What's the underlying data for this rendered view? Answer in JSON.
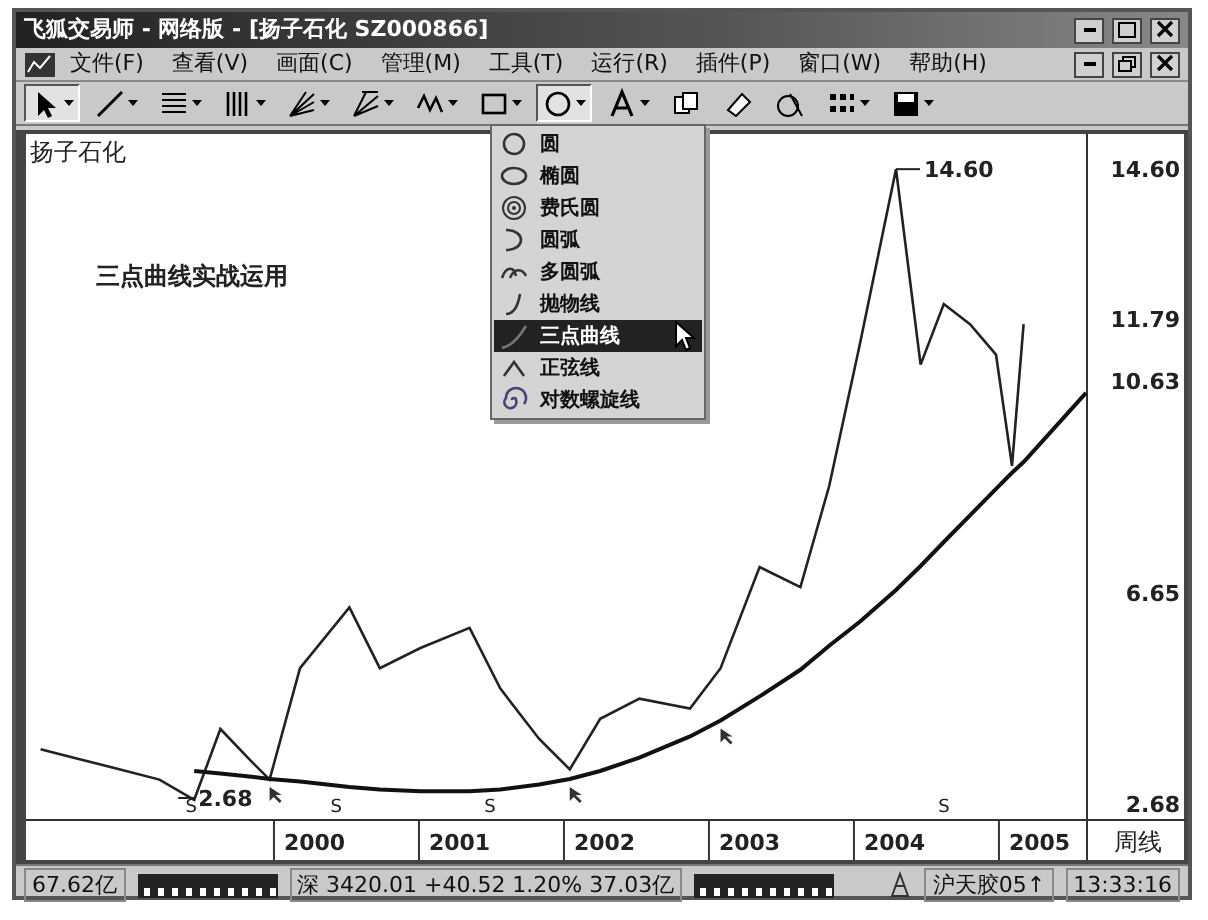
{
  "window": {
    "title": "飞狐交易师 - 网络版 - [扬子石化 SZ000866]"
  },
  "menu": [
    "文件(F)",
    "查看(V)",
    "画面(C)",
    "管理(M)",
    "工具(T)",
    "运行(R)",
    "插件(P)",
    "窗口(W)",
    "帮助(H)"
  ],
  "toolbar": [
    {
      "kind": "pointer",
      "pressed": true
    },
    {
      "kind": "line",
      "pressed": false
    },
    {
      "kind": "fib",
      "pressed": false
    },
    {
      "kind": "vlines",
      "pressed": false
    },
    {
      "kind": "fan",
      "pressed": false
    },
    {
      "kind": "gann",
      "pressed": false
    },
    {
      "kind": "wave",
      "pressed": false
    },
    {
      "kind": "rect",
      "pressed": false
    },
    {
      "kind": "circle",
      "pressed": true
    },
    {
      "kind": "text",
      "pressed": false
    },
    {
      "kind": "copy",
      "pressed": false
    },
    {
      "kind": "eraser",
      "pressed": false
    },
    {
      "kind": "delete",
      "pressed": false
    },
    {
      "kind": "grid",
      "pressed": false
    },
    {
      "kind": "save",
      "pressed": false
    }
  ],
  "dropdown": [
    {
      "kind": "circle",
      "label": "圆",
      "selected": false
    },
    {
      "kind": "ellipse",
      "label": "椭圆",
      "selected": false
    },
    {
      "kind": "fibcircle",
      "label": "费氏圆",
      "selected": false
    },
    {
      "kind": "arc",
      "label": "圆弧",
      "selected": false
    },
    {
      "kind": "multiarc",
      "label": "多圆弧",
      "selected": false
    },
    {
      "kind": "parabola",
      "label": "抛物线",
      "selected": false
    },
    {
      "kind": "curve",
      "label": "三点曲线",
      "selected": true
    },
    {
      "kind": "sine",
      "label": "正弦线",
      "selected": false
    },
    {
      "kind": "spiral",
      "label": "对数螺旋线",
      "selected": false
    }
  ],
  "chart": {
    "period": "周线",
    "chart_data": {
      "type": "line",
      "title": "三点曲线实战运用",
      "x": [
        1998.39,
        1998.66,
        1998.94,
        1999.21,
        1999.45,
        1999.63,
        1999.83,
        1999.97,
        2000.18,
        2000.52,
        2000.73,
        2001.01,
        2001.35,
        2001.56,
        2001.83,
        2002.04,
        2002.25,
        2002.52,
        2002.87,
        2003.08,
        2003.35,
        2003.63,
        2003.83,
        2004.04,
        2004.29,
        2004.46,
        2004.62,
        2004.8,
        2004.98,
        2005.09,
        2005.17,
        2005.6
      ],
      "series": [
        {
          "name": "扬子石化",
          "color": "#222222",
          "values": [
            3.71,
            3.52,
            3.33,
            3.14,
            2.76,
            4.09,
            3.52,
            3.14,
            5.23,
            6.37,
            5.23,
            5.61,
            5.99,
            4.85,
            3.9,
            3.33,
            4.28,
            4.66,
            4.47,
            5.23,
            7.13,
            6.75,
            8.65,
            11.31,
            14.6,
            10.93,
            12.07,
            11.69,
            11.12,
            9.03,
            11.69,
            null
          ]
        },
        {
          "color": "#111111",
          "values": [
            null,
            null,
            null,
            null,
            3.3,
            3.25,
            3.2,
            3.15,
            3.1,
            3.0,
            2.95,
            2.92,
            2.92,
            2.95,
            3.05,
            3.15,
            3.3,
            3.55,
            3.95,
            4.25,
            4.7,
            5.2,
            5.65,
            6.1,
            6.7,
            7.15,
            7.6,
            8.1,
            8.6,
            8.9,
            9.1,
            10.4
          ]
        }
      ],
      "xlim": [
        1998.29,
        2006.29
      ],
      "ylim": [
        2.38,
        15.26
      ],
      "xticks": [
        {
          "value": 2000.28,
          "label": "2000"
        },
        {
          "value": 2001.28,
          "label": "2001"
        },
        {
          "value": 2002.28,
          "label": "2002"
        },
        {
          "value": 2003.28,
          "label": "2003"
        },
        {
          "value": 2004.28,
          "label": "2004"
        },
        {
          "value": 2005.28,
          "label": "2005"
        }
      ],
      "yticks": [
        {
          "value": 2.68,
          "label": "2.68"
        },
        {
          "value": 6.65,
          "label": "6.65"
        },
        {
          "value": 10.63,
          "label": "10.63"
        },
        {
          "value": 11.79,
          "label": "11.79"
        },
        {
          "value": 14.6,
          "label": "14.60"
        }
      ],
      "annotations": [
        {
          "text": "14.60",
          "x": 2004.29,
          "y": 14.6
        },
        {
          "text": "2.68",
          "x": 1999.45,
          "y": 2.68
        }
      ]
    },
    "marks": [
      "S",
      "S",
      "S",
      "S"
    ]
  },
  "status_bar": [
    {
      "kind": "text",
      "text": "67.62亿"
    },
    {
      "kind": "meter"
    },
    {
      "kind": "text",
      "text": "深 3420.01 +40.52 1.20% 37.03亿"
    },
    {
      "kind": "meter"
    },
    {
      "kind": "icon"
    },
    {
      "kind": "text",
      "text": "沪天胶05↑"
    },
    {
      "kind": "text",
      "text": "13:33:16"
    }
  ]
}
